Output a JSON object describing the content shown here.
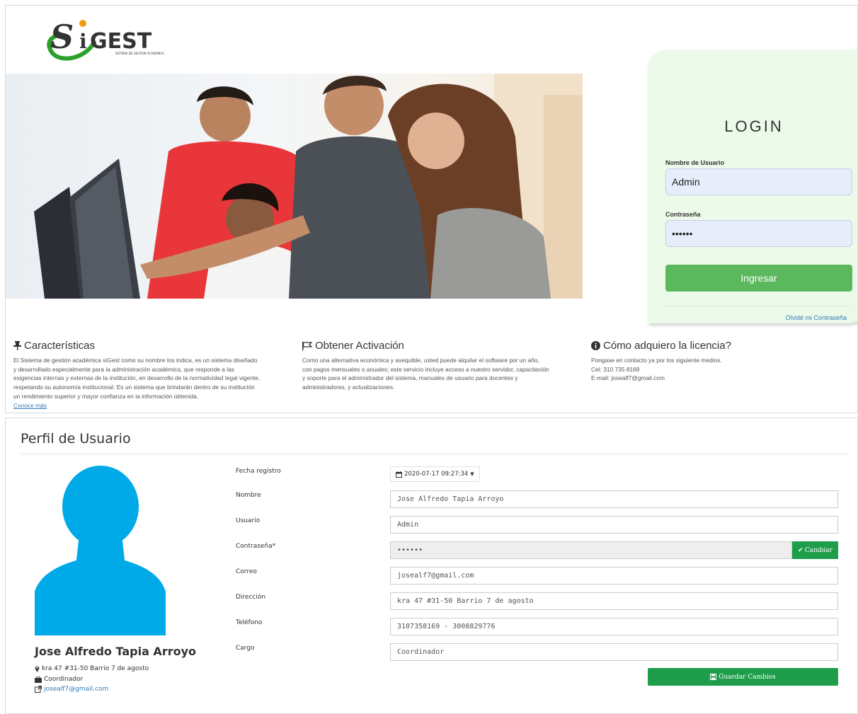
{
  "brand": {
    "logo_text": "GEST",
    "logo_subtitle": "SISTEMA DE GESTION ACADEMICA"
  },
  "login": {
    "title": "LOGIN",
    "username_label": "Nombre de Usuario",
    "username_value": "Admin",
    "password_label": "Contraseña",
    "password_value": "••••••",
    "submit_label": "Ingresar",
    "forgot_label": "Olvidé mi Contraseña"
  },
  "features": [
    {
      "icon": "pushpin-icon",
      "title": "Características",
      "lines": [
        "El Sistema de gestión académica siGest como su nombre los indica, es un sistema diseñado",
        "y desarrollado especialmente para la administración académica, que responde a las",
        "exigencias internas y externas de la institución, en desarrollo de la normatividad legal vigente,",
        "respetando su autonomía institucional. Es un sistema que brindarán dentro de su institución",
        "un rendimiento superior y mayor confianza en la información obtenida."
      ],
      "link": "Conoce más"
    },
    {
      "icon": "flag-icon",
      "title": "Obtener Activación",
      "lines": [
        "Como una alternativa económica y asequible, usted puede alquilar el software por un año,",
        "con pagos mensuales o anuales; este servicio incluye acceso a nuestro servidor, capacitación",
        "y soporte para el administrador del sistema, manuales de usuario para docentes y",
        "administradores, y actualizaciones."
      ]
    },
    {
      "icon": "info-icon",
      "title": "Cómo adquiero la licencia?",
      "lines": [
        "Pongase en contacto ya por los siguiente medios.",
        "Cel: 310 735 8169",
        "E-mail: josealf7@gmail.com"
      ]
    }
  ],
  "profile": {
    "title": "Perfil de Usuario",
    "name": "Jose Alfredo Tapia Arroyo",
    "address": "kra 47 #31-50 Barrio 7 de agosto",
    "role": "Coordinador",
    "email": "josealf7@gmail.com",
    "registered_label": "Fecha registro",
    "registered_value": "2020-07-17 09:27:34",
    "fields": {
      "nombre": {
        "label": "Nombre",
        "value": "Jose Alfredo Tapia Arroyo"
      },
      "usuario": {
        "label": "Usuario",
        "value": "Admin"
      },
      "contrasena": {
        "label": "Contraseña*",
        "value": "••••••"
      },
      "correo": {
        "label": "Correo",
        "value": "josealf7@gmail.com"
      },
      "direccion": {
        "label": "Dirección",
        "value": "kra 47 #31-50 Barrio 7 de agosto"
      },
      "telefono": {
        "label": "Teléfono",
        "value": "3107358169 - 3008829776"
      },
      "cargo": {
        "label": "Cargo",
        "value": "Coordinador"
      }
    },
    "change_label": "Cambiar",
    "save_label": "Guardar Cambios"
  },
  "colors": {
    "accent_green": "#1e9e4b",
    "login_green": "#5cb85c",
    "login_bg": "#ecfbe9",
    "link_blue": "#337ab7",
    "avatar_blue": "#00a9e8"
  }
}
